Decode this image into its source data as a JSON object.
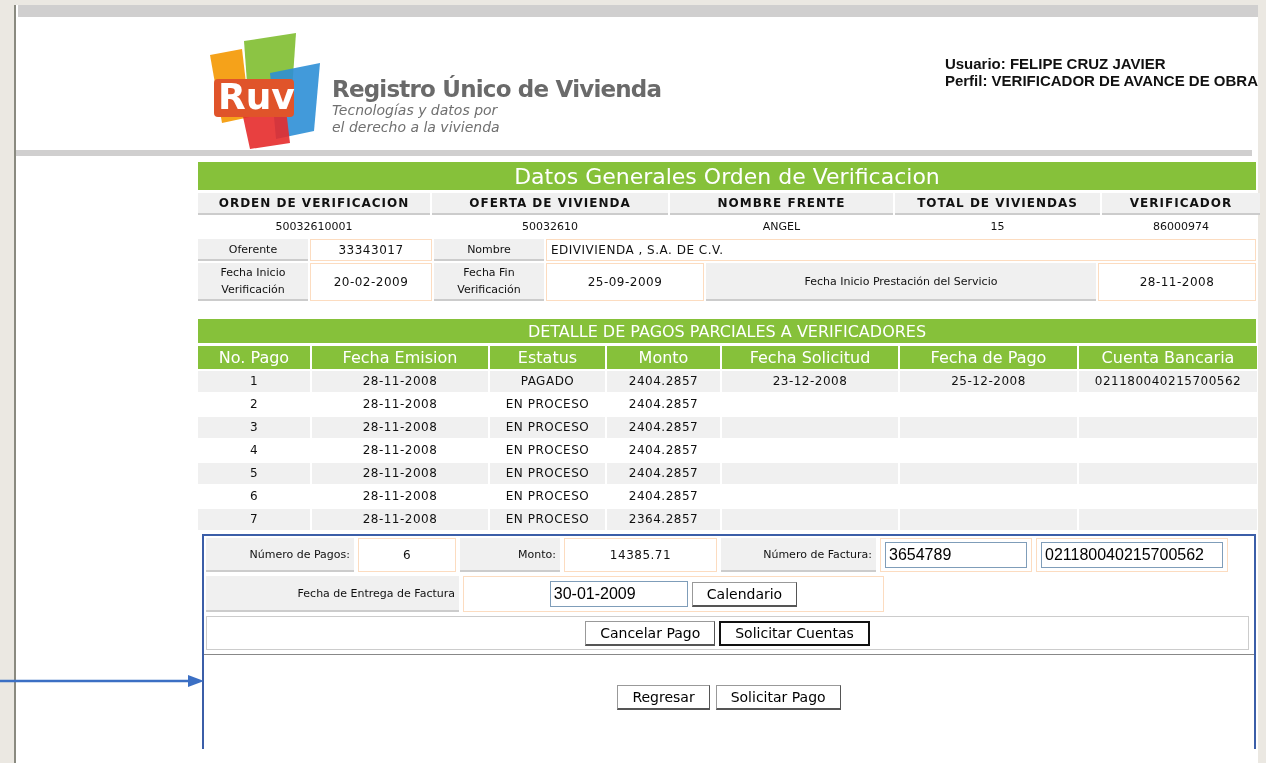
{
  "header": {
    "logo_mark": "Ruv",
    "brand": "Registro Único de Vivienda",
    "tagline": [
      "Tecnologías y datos por",
      "el derecho a la vivienda"
    ],
    "user_lines": [
      "Usuario: FELIPE CRUZ JAVIER",
      "Perfil: VERIFICADOR DE AVANCE DE OBRA"
    ]
  },
  "general": {
    "title": "Datos Generales Orden de Verificacion",
    "columns": [
      "ORDEN DE VERIFICACION",
      "OFERTA DE VIVIENDA",
      "NOMBRE FRENTE",
      "TOTAL DE VIVIENDAS",
      "VERIFICADOR"
    ],
    "values": [
      "50032610001",
      "50032610",
      "ANGEL",
      "15",
      "86000974"
    ],
    "oferente": {
      "label": "Oferente",
      "value": "33343017",
      "name_label": "Nombre",
      "name_value": "EDIVIVIENDA , S.A. DE C.V."
    },
    "dates": [
      {
        "label": "Fecha Inicio Verificación",
        "value": "20-02-2009"
      },
      {
        "label": "Fecha Fin Verificación",
        "value": "25-09-2009"
      },
      {
        "label": "Fecha Inicio Prestación del Servicio",
        "value": "28-11-2008"
      }
    ]
  },
  "payments": {
    "title": "DETALLE DE PAGOS PARCIALES A VERIFICADORES",
    "columns": [
      "No. Pago",
      "Fecha Emision",
      "Estatus",
      "Monto",
      "Fecha Solicitud",
      "Fecha de Pago",
      "Cuenta Bancaria"
    ],
    "rows": [
      [
        "1",
        "28-11-2008",
        "PAGADO",
        "2404.2857",
        "23-12-2008",
        "25-12-2008",
        "021180040215700562"
      ],
      [
        "2",
        "28-11-2008",
        "EN PROCESO",
        "2404.2857",
        "",
        "",
        ""
      ],
      [
        "3",
        "28-11-2008",
        "EN PROCESO",
        "2404.2857",
        "",
        "",
        ""
      ],
      [
        "4",
        "28-11-2008",
        "EN PROCESO",
        "2404.2857",
        "",
        "",
        ""
      ],
      [
        "5",
        "28-11-2008",
        "EN PROCESO",
        "2404.2857",
        "",
        "",
        ""
      ],
      [
        "6",
        "28-11-2008",
        "EN PROCESO",
        "2404.2857",
        "",
        "",
        ""
      ],
      [
        "7",
        "28-11-2008",
        "EN PROCESO",
        "2364.2857",
        "",
        "",
        ""
      ]
    ]
  },
  "request": {
    "num_pagos_label": "Número de Pagos:",
    "num_pagos": "6",
    "monto_label": "Monto:",
    "monto": "14385.71",
    "factura_label": "Número de Factura:",
    "factura": "3654789",
    "cuenta": "021180040215700562",
    "fecha_label": "Fecha de Entrega de Factura",
    "fecha": "30-01-2009",
    "calendar_button": "Calendario",
    "buttons": [
      {
        "label": "Cancelar Pago",
        "focused": false
      },
      {
        "label": "Solicitar Cuentas",
        "focused": true
      }
    ],
    "footer_buttons": [
      {
        "label": "Regresar",
        "focused": false
      },
      {
        "label": "Solicitar Pago",
        "focused": false
      }
    ]
  }
}
